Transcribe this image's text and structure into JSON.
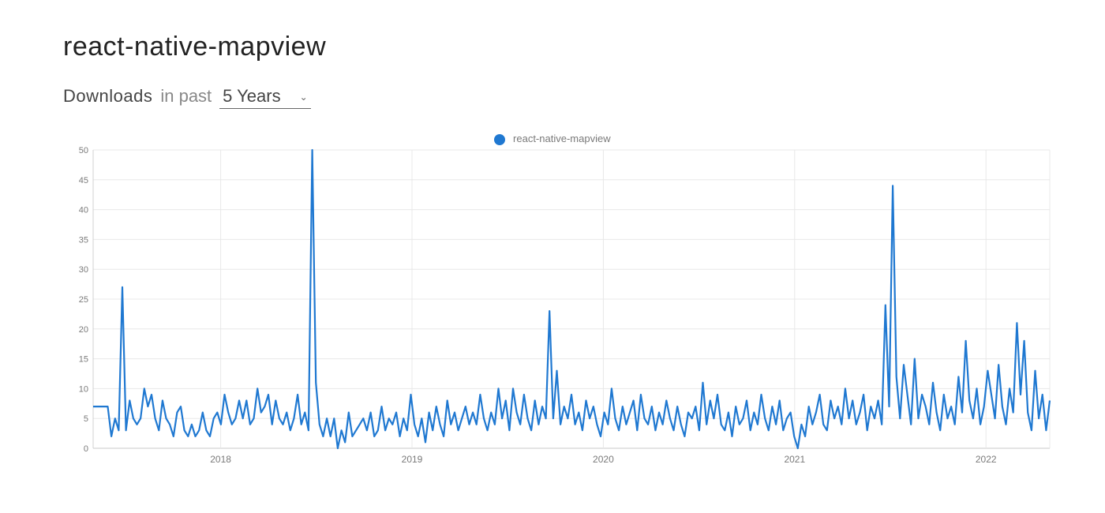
{
  "title": "react-native-mapview",
  "subline": {
    "downloads_label": "Downloads",
    "in_past_label": "in past",
    "range_selected": "5 Years"
  },
  "legend": {
    "series_name": "react-native-mapview"
  },
  "colors": {
    "line": "#1f78d1"
  },
  "chart_data": {
    "type": "line",
    "title": "",
    "xlabel": "",
    "ylabel": "",
    "ylim": [
      0,
      50
    ],
    "y_ticks": [
      0,
      5,
      10,
      15,
      20,
      25,
      30,
      35,
      40,
      45,
      50
    ],
    "x_ticks": [
      "2018",
      "2019",
      "2020",
      "2021",
      "2022"
    ],
    "x_range": [
      "2017-05",
      "2022-05"
    ],
    "series": [
      {
        "name": "react-native-mapview",
        "x": [
          "2017-05",
          "2017-05",
          "2017-05",
          "2017-05",
          "2017-06",
          "2017-06",
          "2017-06",
          "2017-06",
          "2017-07",
          "2017-07",
          "2017-07",
          "2017-07",
          "2017-07",
          "2017-08",
          "2017-08",
          "2017-08",
          "2017-08",
          "2017-09",
          "2017-09",
          "2017-09",
          "2017-09",
          "2017-10",
          "2017-10",
          "2017-10",
          "2017-10",
          "2017-10",
          "2017-11",
          "2017-11",
          "2017-11",
          "2017-11",
          "2017-12",
          "2017-12",
          "2017-12",
          "2017-12",
          "2018-01",
          "2018-01",
          "2018-01",
          "2018-01",
          "2018-01",
          "2018-02",
          "2018-02",
          "2018-02",
          "2018-02",
          "2018-03",
          "2018-03",
          "2018-03",
          "2018-03",
          "2018-04",
          "2018-04",
          "2018-04",
          "2018-04",
          "2018-04",
          "2018-05",
          "2018-05",
          "2018-05",
          "2018-05",
          "2018-06",
          "2018-06",
          "2018-06",
          "2018-06",
          "2018-07",
          "2018-07",
          "2018-07",
          "2018-07",
          "2018-07",
          "2018-08",
          "2018-08",
          "2018-08",
          "2018-08",
          "2018-09",
          "2018-09",
          "2018-09",
          "2018-09",
          "2018-10",
          "2018-10",
          "2018-10",
          "2018-10",
          "2018-10",
          "2018-11",
          "2018-11",
          "2018-11",
          "2018-11",
          "2018-12",
          "2018-12",
          "2018-12",
          "2018-12",
          "2019-01",
          "2019-01",
          "2019-01",
          "2019-01",
          "2019-01",
          "2019-02",
          "2019-02",
          "2019-02",
          "2019-02",
          "2019-03",
          "2019-03",
          "2019-03",
          "2019-03",
          "2019-04",
          "2019-04",
          "2019-04",
          "2019-04",
          "2019-04",
          "2019-05",
          "2019-05",
          "2019-05",
          "2019-05",
          "2019-06",
          "2019-06",
          "2019-06",
          "2019-06",
          "2019-07",
          "2019-07",
          "2019-07",
          "2019-07",
          "2019-07",
          "2019-08",
          "2019-08",
          "2019-08",
          "2019-08",
          "2019-09",
          "2019-09",
          "2019-09",
          "2019-09",
          "2019-10",
          "2019-10",
          "2019-10",
          "2019-10",
          "2019-10",
          "2019-11",
          "2019-11",
          "2019-11",
          "2019-11",
          "2019-12",
          "2019-12",
          "2019-12",
          "2019-12",
          "2020-01",
          "2020-01",
          "2020-01",
          "2020-01",
          "2020-01",
          "2020-02",
          "2020-02",
          "2020-02",
          "2020-02",
          "2020-03",
          "2020-03",
          "2020-03",
          "2020-03",
          "2020-04",
          "2020-04",
          "2020-04",
          "2020-04",
          "2020-04",
          "2020-05",
          "2020-05",
          "2020-05",
          "2020-05",
          "2020-06",
          "2020-06",
          "2020-06",
          "2020-06",
          "2020-07",
          "2020-07",
          "2020-07",
          "2020-07",
          "2020-07",
          "2020-08",
          "2020-08",
          "2020-08",
          "2020-08",
          "2020-09",
          "2020-09",
          "2020-09",
          "2020-09",
          "2020-10",
          "2020-10",
          "2020-10",
          "2020-10",
          "2020-10",
          "2020-11",
          "2020-11",
          "2020-11",
          "2020-11",
          "2020-12",
          "2020-12",
          "2020-12",
          "2020-12",
          "2021-01",
          "2021-01",
          "2021-01",
          "2021-01",
          "2021-01",
          "2021-02",
          "2021-02",
          "2021-02",
          "2021-02",
          "2021-03",
          "2021-03",
          "2021-03",
          "2021-03",
          "2021-04",
          "2021-04",
          "2021-04",
          "2021-04",
          "2021-04",
          "2021-05",
          "2021-05",
          "2021-05",
          "2021-05",
          "2021-06",
          "2021-06",
          "2021-06",
          "2021-06",
          "2021-07",
          "2021-07",
          "2021-07",
          "2021-07",
          "2021-07",
          "2021-08",
          "2021-08",
          "2021-08",
          "2021-08",
          "2021-09",
          "2021-09",
          "2021-09",
          "2021-09",
          "2021-10",
          "2021-10",
          "2021-10",
          "2021-10",
          "2021-10",
          "2021-11",
          "2021-11",
          "2021-11",
          "2021-11",
          "2021-12",
          "2021-12",
          "2021-12",
          "2021-12",
          "2022-01",
          "2022-01",
          "2022-01",
          "2022-01",
          "2022-01",
          "2022-02",
          "2022-02",
          "2022-02",
          "2022-02",
          "2022-03",
          "2022-03",
          "2022-03",
          "2022-03",
          "2022-04",
          "2022-04",
          "2022-04",
          "2022-04",
          "2022-04",
          "2022-05",
          "2022-05",
          "2022-05"
        ],
        "values": [
          7,
          7,
          7,
          7,
          7,
          2,
          5,
          3,
          27,
          3,
          8,
          5,
          4,
          5,
          10,
          7,
          9,
          5,
          3,
          8,
          5,
          4,
          2,
          6,
          7,
          3,
          2,
          4,
          2,
          3,
          6,
          3,
          2,
          5,
          6,
          4,
          9,
          6,
          4,
          5,
          8,
          5,
          8,
          4,
          5,
          10,
          6,
          7,
          9,
          4,
          8,
          5,
          4,
          6,
          3,
          5,
          9,
          4,
          6,
          3,
          50,
          11,
          4,
          2,
          5,
          2,
          5,
          0,
          3,
          1,
          6,
          2,
          3,
          4,
          5,
          3,
          6,
          2,
          3,
          7,
          3,
          5,
          4,
          6,
          2,
          5,
          3,
          9,
          4,
          2,
          5,
          1,
          6,
          3,
          7,
          4,
          2,
          8,
          4,
          6,
          3,
          5,
          7,
          4,
          6,
          4,
          9,
          5,
          3,
          6,
          4,
          10,
          5,
          8,
          3,
          10,
          6,
          4,
          9,
          5,
          3,
          8,
          4,
          7,
          5,
          23,
          5,
          13,
          4,
          7,
          5,
          9,
          4,
          6,
          3,
          8,
          5,
          7,
          4,
          2,
          6,
          4,
          10,
          5,
          3,
          7,
          4,
          6,
          8,
          3,
          9,
          5,
          4,
          7,
          3,
          6,
          4,
          8,
          5,
          3,
          7,
          4,
          2,
          6,
          5,
          7,
          3,
          11,
          4,
          8,
          5,
          9,
          4,
          3,
          6,
          2,
          7,
          4,
          5,
          8,
          3,
          6,
          4,
          9,
          5,
          3,
          7,
          4,
          8,
          3,
          5,
          6,
          2,
          0,
          4,
          2,
          7,
          4,
          6,
          9,
          4,
          3,
          8,
          5,
          7,
          4,
          10,
          5,
          8,
          4,
          6,
          9,
          3,
          7,
          5,
          8,
          4,
          24,
          7,
          44,
          12,
          5,
          14,
          9,
          4,
          15,
          5,
          9,
          7,
          4,
          11,
          6,
          3,
          9,
          5,
          7,
          4,
          12,
          6,
          18,
          8,
          5,
          10,
          4,
          7,
          13,
          9,
          5,
          14,
          7,
          4,
          10,
          6,
          21,
          9,
          18,
          6,
          3,
          13,
          5,
          9,
          3,
          8
        ]
      }
    ]
  }
}
